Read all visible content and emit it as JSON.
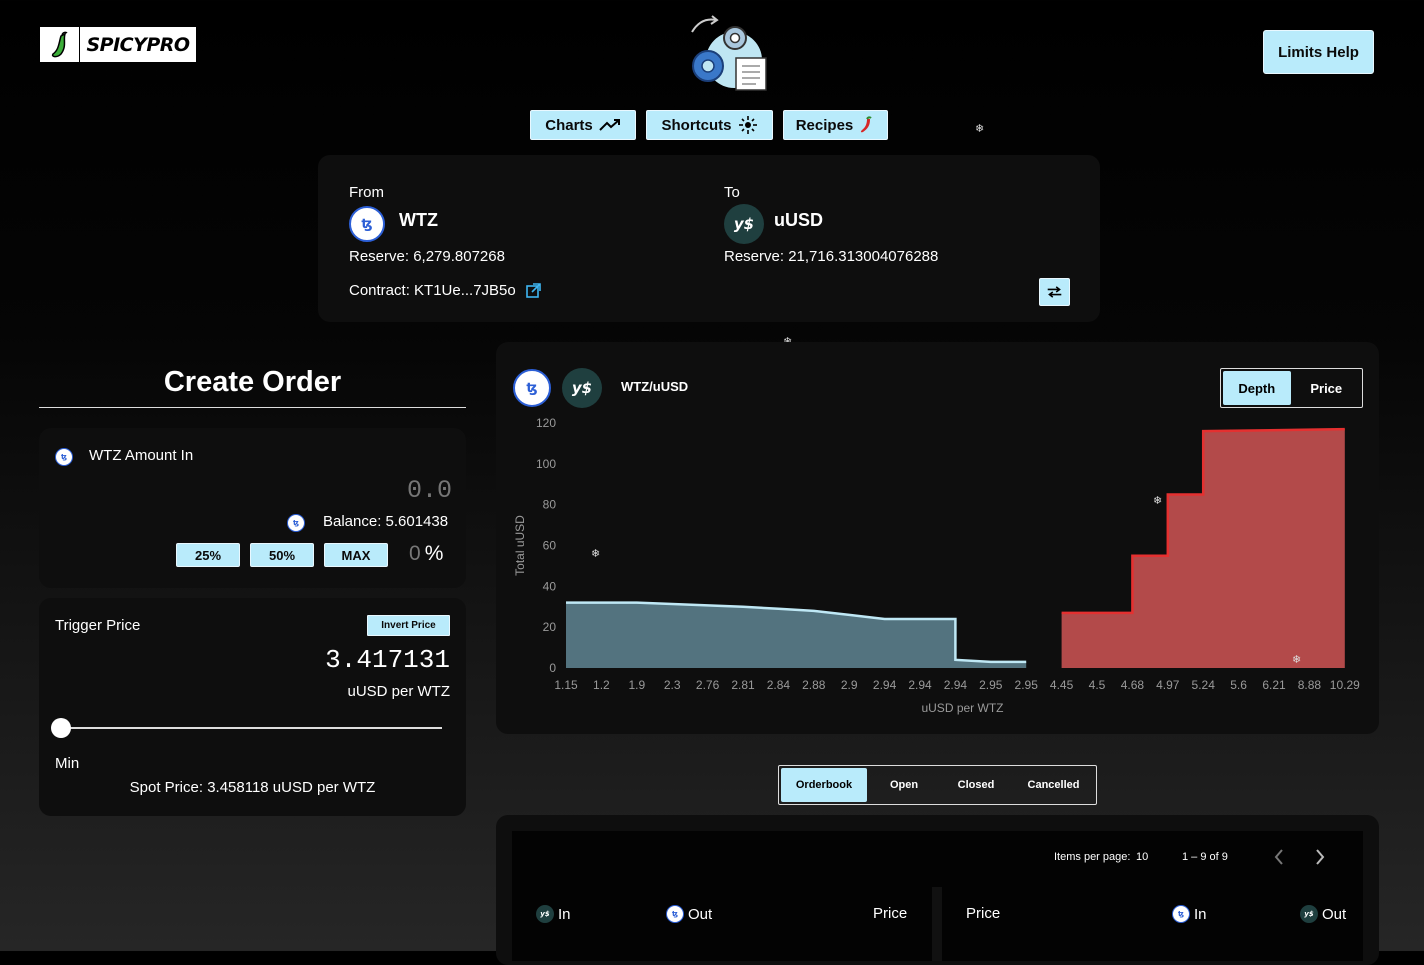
{
  "brand": {
    "name": "SPICYPRO"
  },
  "header": {
    "limits_help": "Limits Help"
  },
  "nav": {
    "charts": "Charts",
    "shortcuts": "Shortcuts",
    "recipes": "Recipes"
  },
  "pair": {
    "from_label": "From",
    "from_token": "WTZ",
    "from_reserve": "Reserve: 6,279.807268",
    "contract": "Contract: KT1Ue...7JB5o",
    "to_label": "To",
    "to_token": "uUSD",
    "to_reserve": "Reserve: 21,716.313004076288"
  },
  "order": {
    "title": "Create Order",
    "amount_label": "WTZ Amount In",
    "amount_placeholder": "0.0",
    "balance": "Balance: 5.601438",
    "pct_25": "25%",
    "pct_50": "50%",
    "pct_max": "MAX",
    "pct_value": "0",
    "pct_symbol": "%",
    "trigger_label": "Trigger Price",
    "invert_price": "Invert Price",
    "trigger_value": "3.417131",
    "trigger_unit": "uUSD per WTZ",
    "slider_min_label": "Min",
    "slider_level": 0,
    "spot_price": "Spot Price: 3.458118 uUSD per WTZ"
  },
  "chart_panel": {
    "pair_label": "WTZ/uUSD",
    "toggle_depth": "Depth",
    "toggle_price": "Price",
    "active_toggle": "Depth"
  },
  "chart_data": {
    "type": "area",
    "title": "",
    "xlabel": "uUSD per WTZ",
    "ylabel": "Total uUSD",
    "ylim": [
      0,
      120
    ],
    "yticks": [
      0,
      20,
      40,
      60,
      80,
      100,
      120
    ],
    "categories": [
      "1.15",
      "1.2",
      "1.9",
      "2.3",
      "2.76",
      "2.81",
      "2.84",
      "2.88",
      "2.9",
      "2.94",
      "2.94",
      "2.94",
      "2.95",
      "2.95",
      "4.45",
      "4.5",
      "4.68",
      "4.97",
      "5.24",
      "5.6",
      "6.21",
      "8.88",
      "10.29"
    ],
    "series": [
      {
        "side": "bid",
        "color": "#53737f",
        "line": "#bfe8f5",
        "points": [
          [
            0,
            32
          ],
          [
            2,
            32
          ],
          [
            5,
            30
          ],
          [
            6,
            29
          ],
          [
            7,
            28
          ],
          [
            8,
            26
          ],
          [
            9,
            24
          ],
          [
            11,
            24
          ],
          [
            11,
            4
          ],
          [
            12,
            3
          ],
          [
            13,
            3
          ]
        ]
      },
      {
        "side": "ask",
        "color": "#b34a4a",
        "line": "#e53030",
        "points": [
          [
            14,
            27
          ],
          [
            16,
            27
          ],
          [
            16,
            55
          ],
          [
            17,
            55
          ],
          [
            17,
            85
          ],
          [
            18,
            85
          ],
          [
            18,
            116
          ],
          [
            22,
            117
          ]
        ]
      }
    ],
    "grid": false
  },
  "orders_tabs": {
    "orderbook": "Orderbook",
    "open": "Open",
    "closed": "Closed",
    "cancelled": "Cancelled",
    "active": "Orderbook"
  },
  "orderbook": {
    "items_per_page_label": "Items per page:",
    "items_per_page": "10",
    "range": "1 – 9 of 9",
    "left_headers": {
      "in": "In",
      "out": "Out",
      "price": "Price"
    },
    "right_headers": {
      "price": "Price",
      "in": "In",
      "out": "Out"
    }
  },
  "colors": {
    "accent": "#b9ebfb",
    "bid_fill": "#53737f",
    "ask_fill": "#b34a4a",
    "ask_line": "#e53030"
  }
}
